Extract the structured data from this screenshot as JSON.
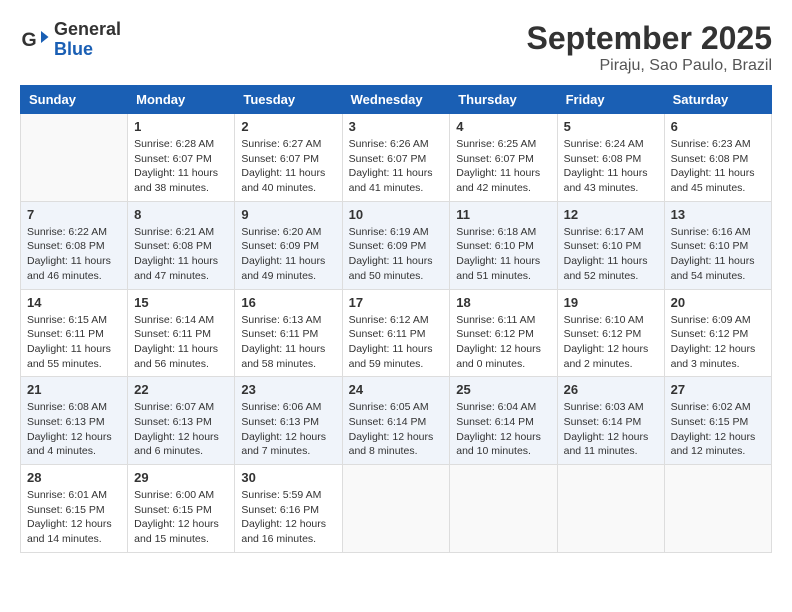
{
  "logo": {
    "line1": "General",
    "line2": "Blue"
  },
  "title": "September 2025",
  "location": "Piraju, Sao Paulo, Brazil",
  "weekdays": [
    "Sunday",
    "Monday",
    "Tuesday",
    "Wednesday",
    "Thursday",
    "Friday",
    "Saturday"
  ],
  "weeks": [
    [
      {
        "day": "",
        "empty": true
      },
      {
        "day": "1",
        "sunrise": "6:28 AM",
        "sunset": "6:07 PM",
        "daylight": "11 hours and 38 minutes."
      },
      {
        "day": "2",
        "sunrise": "6:27 AM",
        "sunset": "6:07 PM",
        "daylight": "11 hours and 40 minutes."
      },
      {
        "day": "3",
        "sunrise": "6:26 AM",
        "sunset": "6:07 PM",
        "daylight": "11 hours and 41 minutes."
      },
      {
        "day": "4",
        "sunrise": "6:25 AM",
        "sunset": "6:07 PM",
        "daylight": "11 hours and 42 minutes."
      },
      {
        "day": "5",
        "sunrise": "6:24 AM",
        "sunset": "6:08 PM",
        "daylight": "11 hours and 43 minutes."
      },
      {
        "day": "6",
        "sunrise": "6:23 AM",
        "sunset": "6:08 PM",
        "daylight": "11 hours and 45 minutes."
      }
    ],
    [
      {
        "day": "7",
        "sunrise": "6:22 AM",
        "sunset": "6:08 PM",
        "daylight": "11 hours and 46 minutes."
      },
      {
        "day": "8",
        "sunrise": "6:21 AM",
        "sunset": "6:08 PM",
        "daylight": "11 hours and 47 minutes."
      },
      {
        "day": "9",
        "sunrise": "6:20 AM",
        "sunset": "6:09 PM",
        "daylight": "11 hours and 49 minutes."
      },
      {
        "day": "10",
        "sunrise": "6:19 AM",
        "sunset": "6:09 PM",
        "daylight": "11 hours and 50 minutes."
      },
      {
        "day": "11",
        "sunrise": "6:18 AM",
        "sunset": "6:10 PM",
        "daylight": "11 hours and 51 minutes."
      },
      {
        "day": "12",
        "sunrise": "6:17 AM",
        "sunset": "6:10 PM",
        "daylight": "11 hours and 52 minutes."
      },
      {
        "day": "13",
        "sunrise": "6:16 AM",
        "sunset": "6:10 PM",
        "daylight": "11 hours and 54 minutes."
      }
    ],
    [
      {
        "day": "14",
        "sunrise": "6:15 AM",
        "sunset": "6:11 PM",
        "daylight": "11 hours and 55 minutes."
      },
      {
        "day": "15",
        "sunrise": "6:14 AM",
        "sunset": "6:11 PM",
        "daylight": "11 hours and 56 minutes."
      },
      {
        "day": "16",
        "sunrise": "6:13 AM",
        "sunset": "6:11 PM",
        "daylight": "11 hours and 58 minutes."
      },
      {
        "day": "17",
        "sunrise": "6:12 AM",
        "sunset": "6:11 PM",
        "daylight": "11 hours and 59 minutes."
      },
      {
        "day": "18",
        "sunrise": "6:11 AM",
        "sunset": "6:12 PM",
        "daylight": "12 hours and 0 minutes."
      },
      {
        "day": "19",
        "sunrise": "6:10 AM",
        "sunset": "6:12 PM",
        "daylight": "12 hours and 2 minutes."
      },
      {
        "day": "20",
        "sunrise": "6:09 AM",
        "sunset": "6:12 PM",
        "daylight": "12 hours and 3 minutes."
      }
    ],
    [
      {
        "day": "21",
        "sunrise": "6:08 AM",
        "sunset": "6:13 PM",
        "daylight": "12 hours and 4 minutes."
      },
      {
        "day": "22",
        "sunrise": "6:07 AM",
        "sunset": "6:13 PM",
        "daylight": "12 hours and 6 minutes."
      },
      {
        "day": "23",
        "sunrise": "6:06 AM",
        "sunset": "6:13 PM",
        "daylight": "12 hours and 7 minutes."
      },
      {
        "day": "24",
        "sunrise": "6:05 AM",
        "sunset": "6:14 PM",
        "daylight": "12 hours and 8 minutes."
      },
      {
        "day": "25",
        "sunrise": "6:04 AM",
        "sunset": "6:14 PM",
        "daylight": "12 hours and 10 minutes."
      },
      {
        "day": "26",
        "sunrise": "6:03 AM",
        "sunset": "6:14 PM",
        "daylight": "12 hours and 11 minutes."
      },
      {
        "day": "27",
        "sunrise": "6:02 AM",
        "sunset": "6:15 PM",
        "daylight": "12 hours and 12 minutes."
      }
    ],
    [
      {
        "day": "28",
        "sunrise": "6:01 AM",
        "sunset": "6:15 PM",
        "daylight": "12 hours and 14 minutes."
      },
      {
        "day": "29",
        "sunrise": "6:00 AM",
        "sunset": "6:15 PM",
        "daylight": "12 hours and 15 minutes."
      },
      {
        "day": "30",
        "sunrise": "5:59 AM",
        "sunset": "6:16 PM",
        "daylight": "12 hours and 16 minutes."
      },
      {
        "day": "",
        "empty": true
      },
      {
        "day": "",
        "empty": true
      },
      {
        "day": "",
        "empty": true
      },
      {
        "day": "",
        "empty": true
      }
    ]
  ]
}
